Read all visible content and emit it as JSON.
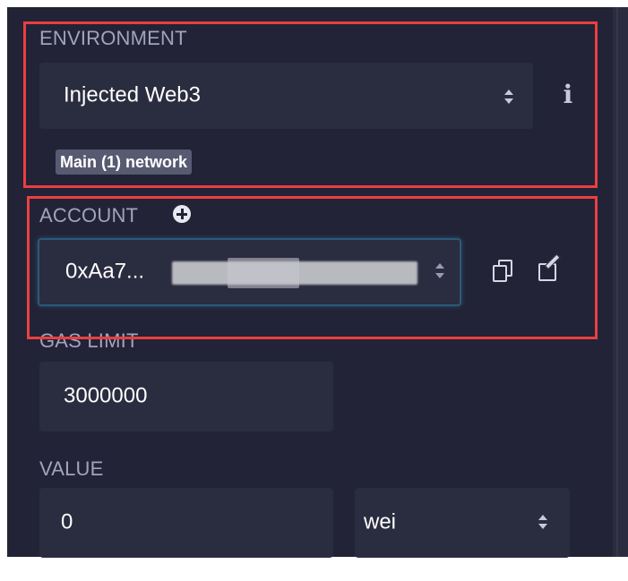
{
  "environment": {
    "label": "ENVIRONMENT",
    "selected": "Injected Web3",
    "info_icon": "info-icon",
    "network_badge": "Main (1) network"
  },
  "account": {
    "label": "ACCOUNT",
    "add_icon": "plus-circle-icon",
    "selected": "0xAa7...",
    "copy_icon": "copy-icon",
    "edit_icon": "edit-icon"
  },
  "gas_limit": {
    "label": "GAS LIMIT",
    "value": "3000000"
  },
  "value": {
    "label": "VALUE",
    "amount": "0",
    "unit": "wei"
  },
  "colors": {
    "panel_bg": "#222336",
    "field_bg": "#2a2c3f",
    "label_text": "#a2a3bd",
    "highlight_box": "#ea3f3f",
    "focus_border": "#2b5a78"
  }
}
